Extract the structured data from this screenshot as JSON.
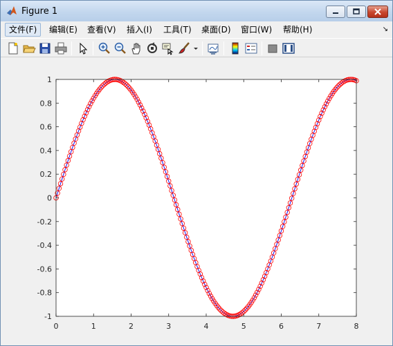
{
  "window": {
    "title": "Figure 1",
    "controls": [
      "minimize",
      "maximize",
      "close"
    ]
  },
  "menu": {
    "items": [
      "文件(F)",
      "编辑(E)",
      "查看(V)",
      "插入(I)",
      "工具(T)",
      "桌面(D)",
      "窗口(W)",
      "帮助(H)"
    ],
    "active": "文件(F)",
    "overflow_icon": "arrow-curve-icon"
  },
  "toolbar": {
    "buttons": [
      "new-figure-icon",
      "open-file-icon",
      "save-icon",
      "print-icon",
      "edit-plot-icon",
      "zoom-in-icon",
      "zoom-out-icon",
      "pan-icon",
      "rotate-3d-icon",
      "data-cursor-icon",
      "brush-icon",
      "link-plot-icon",
      "colorbar-icon",
      "legend-icon",
      "hide-plot-tools-icon",
      "show-plot-tools-icon"
    ]
  },
  "chart_data": {
    "type": "line",
    "title": "",
    "xlabel": "",
    "ylabel": "",
    "xlim": [
      0,
      8
    ],
    "ylim": [
      -1,
      1
    ],
    "xticks": [
      "0",
      "1",
      "2",
      "3",
      "4",
      "5",
      "6",
      "7",
      "8"
    ],
    "yticks": [
      "1",
      "0.8",
      "0.6",
      "0.4",
      "0.2",
      "0",
      "-0.2",
      "-0.4",
      "-0.6",
      "-0.8",
      "-1"
    ],
    "grid": false,
    "legend": "none",
    "series": [
      {
        "function": "y = sin(x)",
        "x_start": 0,
        "x_end": 8,
        "x_step": 0.04,
        "line_color": "#0000ff",
        "marker": "circle",
        "marker_color": "#ff0000",
        "y_clip": [
          -1,
          1
        ]
      }
    ]
  }
}
